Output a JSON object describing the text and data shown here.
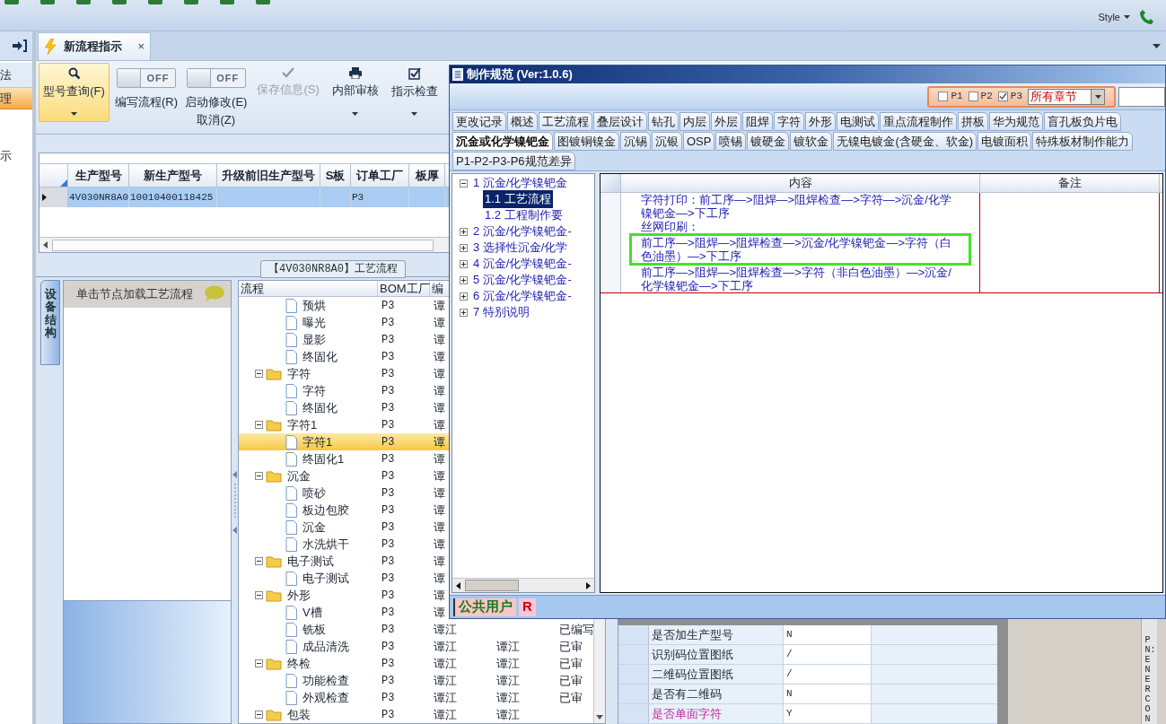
{
  "toolbar": {
    "style_menu": "Style"
  },
  "sidebar": {
    "items": [
      {
        "label": "法",
        "selected": false
      },
      {
        "label": "理",
        "selected": true
      },
      {
        "label": "示",
        "selected": false
      }
    ]
  },
  "tabs": [
    {
      "label": "新流程指示",
      "selected": true,
      "close": "×"
    }
  ],
  "ribbon": {
    "items": [
      {
        "kind": "button",
        "label": "型号查询(F)",
        "selected": true,
        "disabled": false,
        "dropdown": true
      },
      {
        "kind": "toggle",
        "toggle_text": "OFF",
        "on": false,
        "label": "编写流程(R)"
      },
      {
        "kind": "toggle",
        "toggle_text": "OFF",
        "on": false,
        "label": "启动修改(E)",
        "sublabel": "取消(Z)"
      },
      {
        "kind": "button",
        "label": "保存信息(S)",
        "selected": false,
        "disabled": true,
        "dropdown": false
      },
      {
        "kind": "button",
        "label": "内部审核",
        "selected": false,
        "disabled": false,
        "dropdown": true
      },
      {
        "kind": "button",
        "label": "指示检查",
        "selected": false,
        "disabled": false,
        "dropdown": true
      }
    ]
  },
  "model_grid": {
    "columns": [
      "生产型号",
      "新生产型号",
      "升级前旧生产型号",
      "S板",
      "订单工厂",
      "板厚"
    ],
    "rows": [
      {
        "selected": true,
        "cells": [
          "4V030NR8A0",
          "10010400118425",
          null,
          null,
          "P3",
          null
        ]
      }
    ]
  },
  "process_panel": {
    "title": "【4V030NR8A0】工艺流程",
    "side_tab": "设备结构",
    "hint": "单击节点加载工艺流程",
    "tree_grid": {
      "columns": [
        "流程",
        "BOM工厂",
        "编"
      ],
      "rows": [
        {
          "kind": "continuation",
          "children": [
            {
              "kind": "file",
              "label": "预烘",
              "bom": "P3",
              "col3": "谭",
              "selected": false
            },
            {
              "kind": "file",
              "label": "曝光",
              "bom": "P3",
              "col3": "谭",
              "selected": false
            },
            {
              "kind": "file",
              "label": "显影",
              "bom": "P3",
              "col3": "谭",
              "selected": false
            },
            {
              "kind": "file",
              "label": "终固化",
              "bom": "P3",
              "col3": "谭",
              "selected": false
            }
          ]
        },
        {
          "kind": "folder",
          "label": "字符",
          "bom": "P3",
          "col3": "谭",
          "selected": false,
          "expanded": true,
          "children": [
            {
              "kind": "file",
              "label": "字符",
              "bom": "P3",
              "col3": "谭",
              "selected": false
            },
            {
              "kind": "file",
              "label": "终固化",
              "bom": "P3",
              "col3": "谭",
              "selected": false
            }
          ]
        },
        {
          "kind": "folder",
          "label": "字符1",
          "bom": "P3",
          "col3": "谭",
          "selected": false,
          "expanded": true,
          "children": [
            {
              "kind": "file",
              "label": "字符1",
              "bom": "P3",
              "col3": "谭",
              "selected": true
            },
            {
              "kind": "file",
              "label": "终固化1",
              "bom": "P3",
              "col3": "谭",
              "selected": false
            }
          ]
        },
        {
          "kind": "folder",
          "label": "沉金",
          "bom": "P3",
          "col3": "谭",
          "selected": false,
          "expanded": true,
          "children": [
            {
              "kind": "file",
              "label": "喷砂",
              "bom": "P3",
              "col3": "谭",
              "selected": false
            },
            {
              "kind": "file",
              "label": "板边包胶",
              "bom": "P3",
              "col3": "谭",
              "selected": false
            },
            {
              "kind": "file",
              "label": "沉金",
              "bom": "P3",
              "col3": "谭",
              "selected": false
            },
            {
              "kind": "file",
              "label": "水洗烘干",
              "bom": "P3",
              "col3": "谭",
              "selected": false
            }
          ]
        },
        {
          "kind": "folder",
          "label": "电子测试",
          "bom": "P3",
          "col3": "谭",
          "selected": false,
          "expanded": true,
          "children": [
            {
              "kind": "file",
              "label": "电子测试",
              "bom": "P3",
              "col3": "谭",
              "selected": false
            }
          ]
        },
        {
          "kind": "folder",
          "label": "外形",
          "bom": "P3",
          "col3": "谭",
          "selected": false,
          "expanded": true,
          "children": [
            {
              "kind": "file",
              "label": "V槽",
              "bom": "P3",
              "col3": "谭",
              "selected": false
            },
            {
              "kind": "file",
              "label": "铣板",
              "bom": "P3",
              "col3": "谭江",
              "col5": "已编写",
              "selected": false
            },
            {
              "kind": "file",
              "label": "成品清洗",
              "bom": "P3",
              "col3": "谭江",
              "col4": "谭江",
              "col5": "已审",
              "selected": false
            }
          ]
        },
        {
          "kind": "folder",
          "label": "终检",
          "bom": "P3",
          "col3": "谭江",
          "col4": "谭江",
          "col5": "已审",
          "selected": false,
          "expanded": true,
          "children": [
            {
              "kind": "file",
              "label": "功能检查",
              "bom": "P3",
              "col3": "谭江",
              "col4": "谭江",
              "col5": "已审",
              "selected": false
            },
            {
              "kind": "file",
              "label": "外观检查",
              "bom": "P3",
              "col3": "谭江",
              "col4": "谭江",
              "col5": "已审",
              "selected": false
            }
          ]
        },
        {
          "kind": "folder",
          "label": "包装",
          "bom": "P3",
          "col3": "谭江",
          "col4": "谭江",
          "selected": false,
          "expanded": true,
          "children": []
        }
      ]
    },
    "properties": [
      {
        "name": "是否加生产型号",
        "value": "N",
        "highlighted": false
      },
      {
        "name": "识别码位置图纸",
        "value": "/",
        "highlighted": false
      },
      {
        "name": "二维码位置图纸",
        "value": "/",
        "highlighted": false
      },
      {
        "name": "是否有二维码",
        "value": "N",
        "highlighted": false
      },
      {
        "name": "是否单面字符",
        "value": "Y",
        "highlighted": true
      }
    ],
    "side_label": "PN:ENERCON"
  },
  "spec_window": {
    "title": "制作规范 (Ver:1.0.6)",
    "filters": [
      {
        "label": "P1",
        "checked": false
      },
      {
        "label": "P2",
        "checked": false
      },
      {
        "label": "P3",
        "checked": true
      }
    ],
    "chapter_select": "所有章节",
    "tab_rows": [
      [
        {
          "label": "更改记录",
          "selected": false
        },
        {
          "label": "概述",
          "selected": false
        },
        {
          "label": "工艺流程",
          "selected": false
        },
        {
          "label": "叠层设计",
          "selected": false
        },
        {
          "label": "钻孔",
          "selected": false
        },
        {
          "label": "内层",
          "selected": false
        },
        {
          "label": "外层",
          "selected": false
        },
        {
          "label": "阻焊",
          "selected": false
        },
        {
          "label": "字符",
          "selected": false
        },
        {
          "label": "外形",
          "selected": false
        },
        {
          "label": "电测试",
          "selected": false
        },
        {
          "label": "重点流程制作",
          "selected": false
        },
        {
          "label": "拼板",
          "selected": false
        },
        {
          "label": "华为规范",
          "selected": false
        },
        {
          "label": "盲孔板负片电",
          "selected": false
        }
      ],
      [
        {
          "label": "沉金或化学镍钯金",
          "selected": true
        },
        {
          "label": "图镀铜镍金",
          "selected": false
        },
        {
          "label": "沉锡",
          "selected": false
        },
        {
          "label": "沉银",
          "selected": false
        },
        {
          "label": "OSP",
          "selected": false
        },
        {
          "label": "喷锡",
          "selected": false
        },
        {
          "label": "镀硬金",
          "selected": false
        },
        {
          "label": "镀软金",
          "selected": false
        },
        {
          "label": "无镍电镀金(含硬金、软金)",
          "selected": false
        },
        {
          "label": "电镀面积",
          "selected": false
        },
        {
          "label": "特殊板材制作能力",
          "selected": false
        }
      ],
      [
        {
          "label": "P1-P2-P3-P6规范差异",
          "selected": false
        }
      ]
    ],
    "outline": [
      {
        "label": "1 沉金/化学镍钯金",
        "expanded": true,
        "selected": false,
        "children": [
          {
            "label": "1.1 工艺流程",
            "selected": true
          },
          {
            "label": "1.2 工程制作要",
            "selected": false
          }
        ]
      },
      {
        "label": "2 沉金/化学镍钯金-",
        "expanded": false,
        "selected": false
      },
      {
        "label": "3 选择性沉金/化学",
        "expanded": false,
        "selected": false
      },
      {
        "label": "4 沉金/化学镍钯金-",
        "expanded": false,
        "selected": false
      },
      {
        "label": "5 沉金/化学镍钯金-",
        "expanded": false,
        "selected": false
      },
      {
        "label": "6 沉金/化学镍钯金-",
        "expanded": false,
        "selected": false
      },
      {
        "label": "7 特别说明",
        "expanded": false,
        "selected": false
      }
    ],
    "content_grid": {
      "columns": [
        "内容",
        "备注"
      ],
      "paragraphs": [
        {
          "text": "字符打印：前工序—>阻焊—>阻焊检查—>字符—>沉金/化学镍钯金—>下工序",
          "highlighted": false
        },
        {
          "text": "丝网印刷：",
          "highlighted": false
        },
        {
          "text": "前工序—>阻焊—>阻焊检查—>沉金/化学镍钯金—>字符（白色油墨）—>下工序",
          "highlighted": true
        },
        {
          "text": "前工序—>阻焊—>阻焊检查—>字符（非白色油墨）—>沉金/化学镍钯金—>下工序",
          "highlighted": false
        }
      ]
    },
    "status": {
      "user": "公共用户",
      "role": "R"
    }
  }
}
